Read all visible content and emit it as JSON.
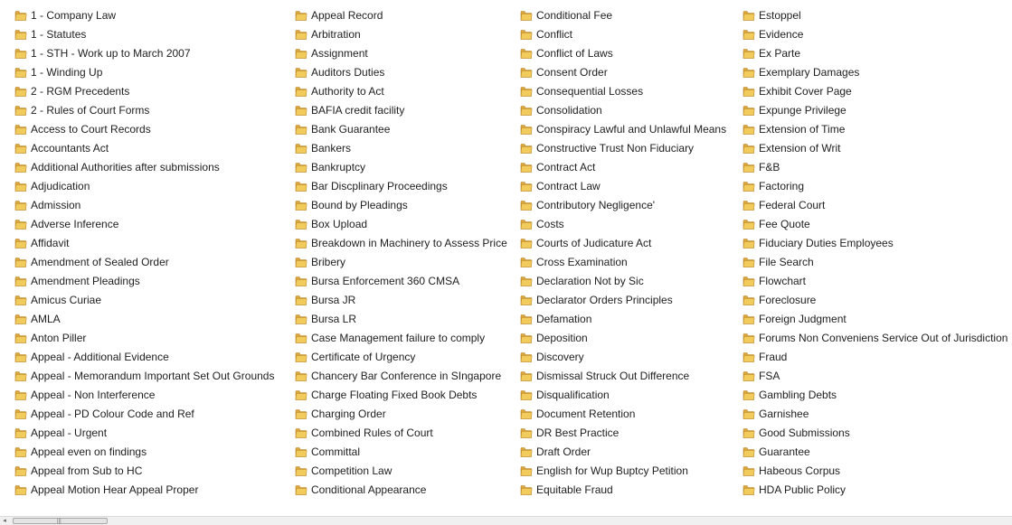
{
  "columns": [
    [
      "1 - Company Law",
      "1 - Statutes",
      "1 - STH - Work up to March 2007",
      "1 - Winding Up",
      "2 - RGM Precedents",
      "2 - Rules of Court Forms",
      "Access to Court Records",
      "Accountants Act",
      "Additional Authorities after submissions",
      "Adjudication",
      "Admission",
      "Adverse Inference",
      "Affidavit",
      "Amendment of Sealed Order",
      "Amendment Pleadings",
      "Amicus Curiae",
      "AMLA",
      "Anton Piller",
      "Appeal - Additional Evidence",
      "Appeal - Memorandum Important Set Out Grounds",
      "Appeal - Non Interference",
      "Appeal - PD Colour Code and Ref",
      "Appeal - Urgent",
      "Appeal even on findings",
      "Appeal from Sub to HC",
      "Appeal Motion Hear Appeal Proper"
    ],
    [
      "Appeal Record",
      "Arbitration",
      "Assignment",
      "Auditors Duties",
      "Authority to Act",
      "BAFIA credit facility",
      "Bank Guarantee",
      "Bankers",
      "Bankruptcy",
      "Bar Discplinary Proceedings",
      "Bound by Pleadings",
      "Box Upload",
      "Breakdown in Machinery to Assess Price",
      "Bribery",
      "Bursa Enforcement 360 CMSA",
      "Bursa JR",
      "Bursa LR",
      "Case Management failure to comply",
      "Certificate of Urgency",
      "Chancery Bar Conference in SIngapore",
      "Charge Floating Fixed Book Debts",
      "Charging Order",
      "Combined Rules of Court",
      "Committal",
      "Competition Law",
      "Conditional Appearance"
    ],
    [
      "Conditional Fee",
      "Conflict",
      "Conflict of Laws",
      "Consent Order",
      "Consequential Losses",
      "Consolidation",
      "Conspiracy Lawful and Unlawful Means",
      "Constructive Trust Non Fiduciary",
      "Contract Act",
      "Contract Law",
      "Contributory Negligence'",
      "Costs",
      "Courts of Judicature Act",
      "Cross Examination",
      "Declaration Not by Sic",
      "Declarator Orders Principles",
      "Defamation",
      "Deposition",
      "Discovery",
      "Dismissal Struck Out Difference",
      "Disqualification",
      "Document Retention",
      "DR Best Practice",
      "Draft Order",
      "English for Wup Buptcy Petition",
      "Equitable Fraud"
    ],
    [
      "Estoppel",
      "Evidence",
      "Ex Parte",
      "Exemplary Damages",
      "Exhibit Cover Page",
      "Expunge Privilege",
      "Extension of Time",
      "Extension of Writ",
      "F&B",
      "Factoring",
      "Federal Court",
      "Fee Quote",
      "Fiduciary Duties Employees",
      "File Search",
      "Flowchart",
      "Foreclosure",
      "Foreign Judgment",
      "Forums Non Conveniens Service Out of Jurisdiction",
      "Fraud",
      "FSA",
      "Gambling Debts",
      "Garnishee",
      "Good Submissions",
      "Guarantee",
      "Habeous Corpus",
      "HDA Public Policy"
    ]
  ],
  "scrollbar": {
    "left_arrow": "◂",
    "grip": "|||"
  },
  "colors": {
    "folder_body": "#f2cb5d",
    "folder_back": "#dba73c",
    "folder_outline": "#b8862a"
  },
  "icon": "folder-icon"
}
